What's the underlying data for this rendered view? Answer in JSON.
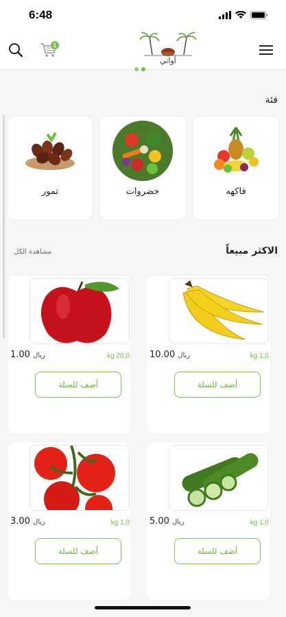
{
  "status": {
    "time": "6:48"
  },
  "header": {
    "logo_text": "أواتي",
    "cart_count": "1"
  },
  "categories": {
    "title": "فئة",
    "items": [
      {
        "label": "فاكهه"
      },
      {
        "label": "خضروات"
      },
      {
        "label": "تمور"
      }
    ]
  },
  "best_sellers": {
    "title": "الاكثر مبيعاً",
    "see_all": "مشاهدة الكل",
    "add_label": "أضف للسلة",
    "currency": "ريال",
    "products": [
      {
        "name": "banana",
        "price": "10.00",
        "weight": "kg 1.0"
      },
      {
        "name": "apple",
        "price": "1.00",
        "weight": "kg 20.0"
      },
      {
        "name": "cucumber",
        "price": "5.00",
        "weight": "kg 1.0"
      },
      {
        "name": "tomato",
        "price": "3.00",
        "weight": "kg 1.0"
      }
    ]
  },
  "colors": {
    "accent": "#6cbf3a",
    "border": "#7cc34e",
    "background": "#f6f6f6"
  }
}
